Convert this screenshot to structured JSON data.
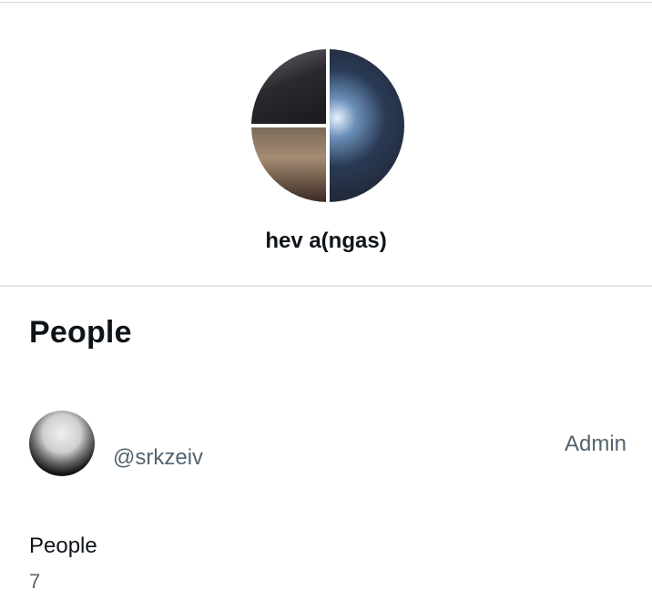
{
  "group": {
    "name": "hev a(ngas)"
  },
  "section": {
    "title": "People"
  },
  "members": [
    {
      "handle": "@srkzeiv",
      "role": "Admin"
    }
  ],
  "summary": {
    "label": "People",
    "count": "7"
  },
  "colors": {
    "text_primary": "#0f1419",
    "text_secondary": "#536471",
    "divider": "#cfd9de"
  }
}
